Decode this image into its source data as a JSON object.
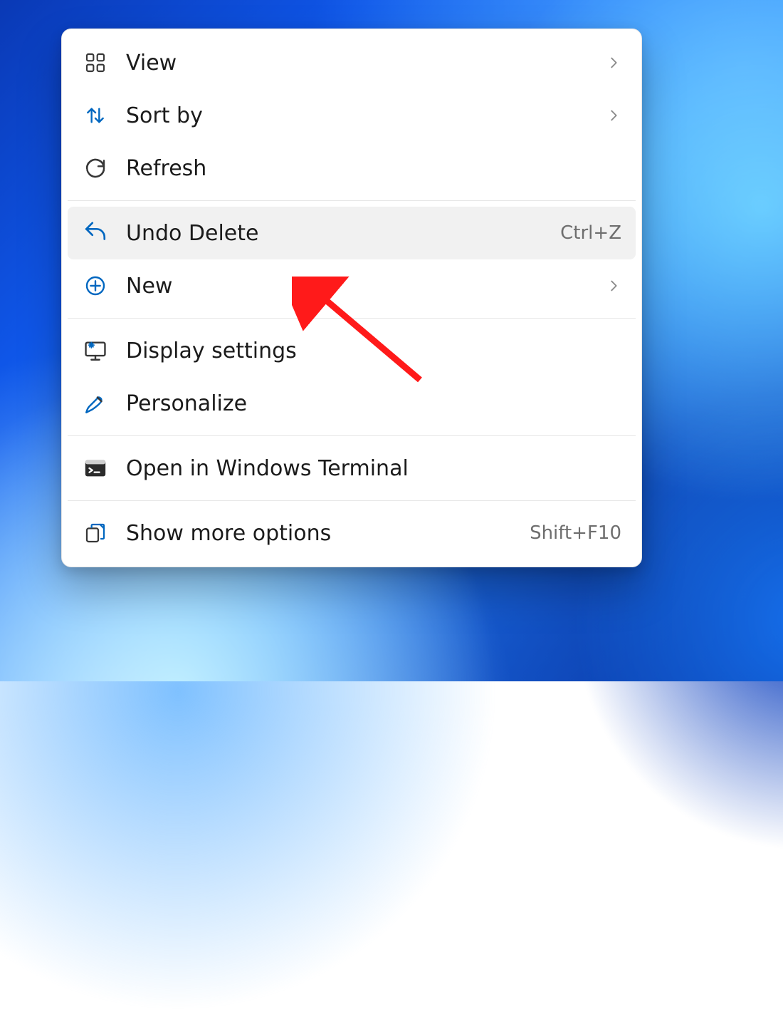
{
  "menu": {
    "items": [
      {
        "label": "View",
        "shortcut": "",
        "submenu": true
      },
      {
        "label": "Sort by",
        "shortcut": "",
        "submenu": true
      },
      {
        "label": "Refresh",
        "shortcut": "",
        "submenu": false
      },
      {
        "label": "Undo Delete",
        "shortcut": "Ctrl+Z",
        "submenu": false
      },
      {
        "label": "New",
        "shortcut": "",
        "submenu": true
      },
      {
        "label": "Display settings",
        "shortcut": "",
        "submenu": false
      },
      {
        "label": "Personalize",
        "shortcut": "",
        "submenu": false
      },
      {
        "label": "Open in Windows Terminal",
        "shortcut": "",
        "submenu": false
      },
      {
        "label": "Show more options",
        "shortcut": "Shift+F10",
        "submenu": false
      }
    ],
    "highlighted_index": 3
  },
  "colors": {
    "accent": "#0067c0",
    "menu_bg": "#ffffff",
    "separator": "#e6e6e6",
    "hover": "#f1f1f1",
    "muted_text": "#6e6e6e",
    "annotation_arrow": "#ff1a1a"
  }
}
